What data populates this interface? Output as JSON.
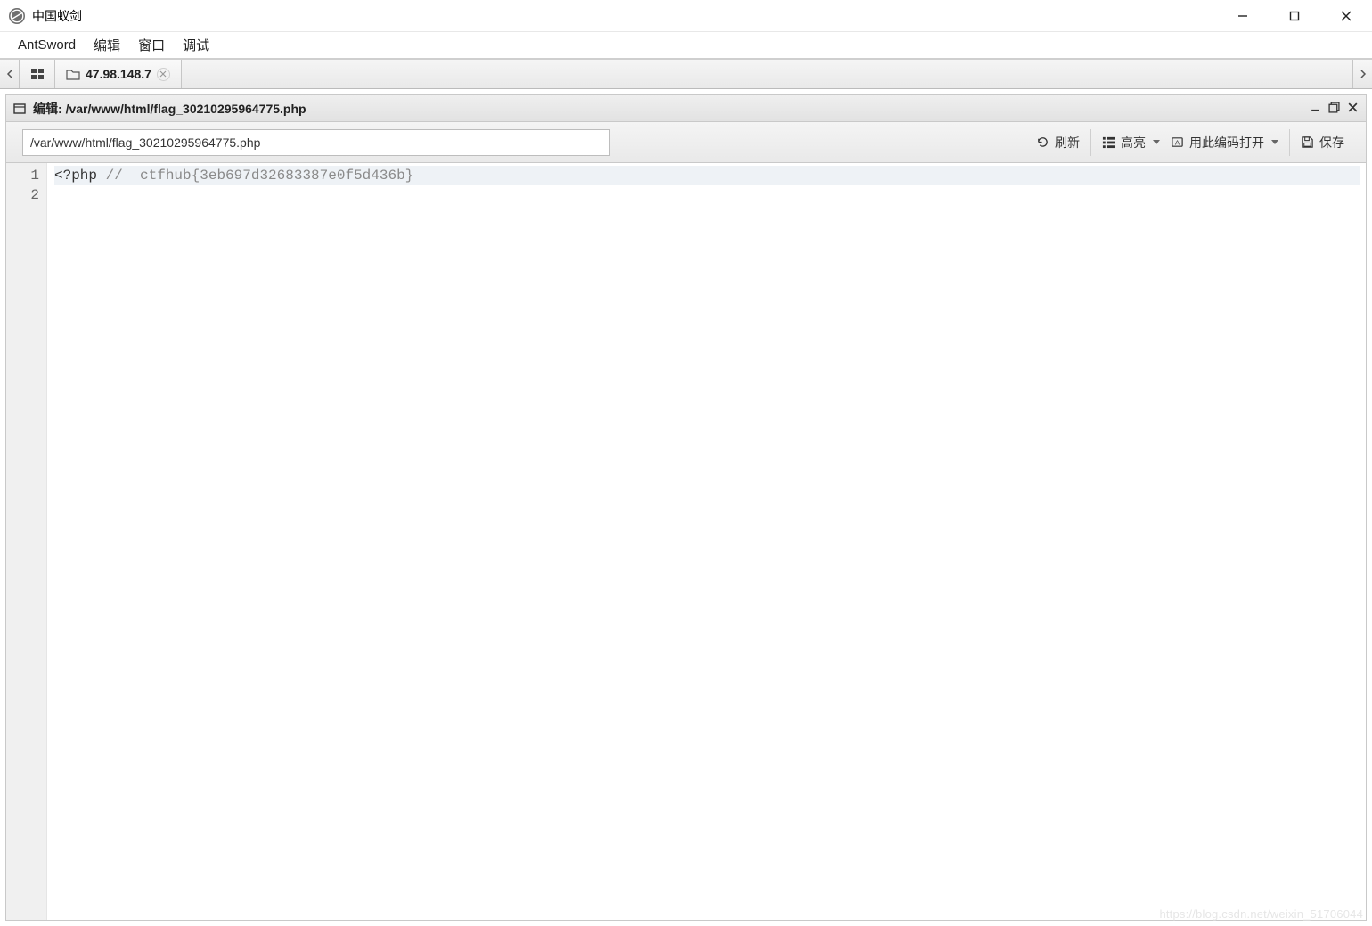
{
  "window": {
    "title": "中国蚁剑"
  },
  "menubar": {
    "items": [
      "AntSword",
      "编辑",
      "窗口",
      "调试"
    ]
  },
  "tabs": {
    "items": [
      {
        "label": "47.98.148.7"
      }
    ]
  },
  "editorPanel": {
    "title_prefix": "编辑: ",
    "title_path": "/var/www/html/flag_30210295964775.php"
  },
  "toolbar": {
    "path_value": "/var/www/html/flag_30210295964775.php",
    "refresh": "刷新",
    "highlight": "高亮",
    "open_with": "用此编码打开",
    "save": "保存"
  },
  "code": {
    "lines": [
      {
        "n": "1",
        "tag": "<?php",
        "comment": " //  ctfhub{3eb697d32683387e0f5d436b}",
        "active": true
      },
      {
        "n": "2",
        "tag": "",
        "comment": "",
        "active": false
      }
    ]
  },
  "watermark": "https://blog.csdn.net/weixin_51706044"
}
